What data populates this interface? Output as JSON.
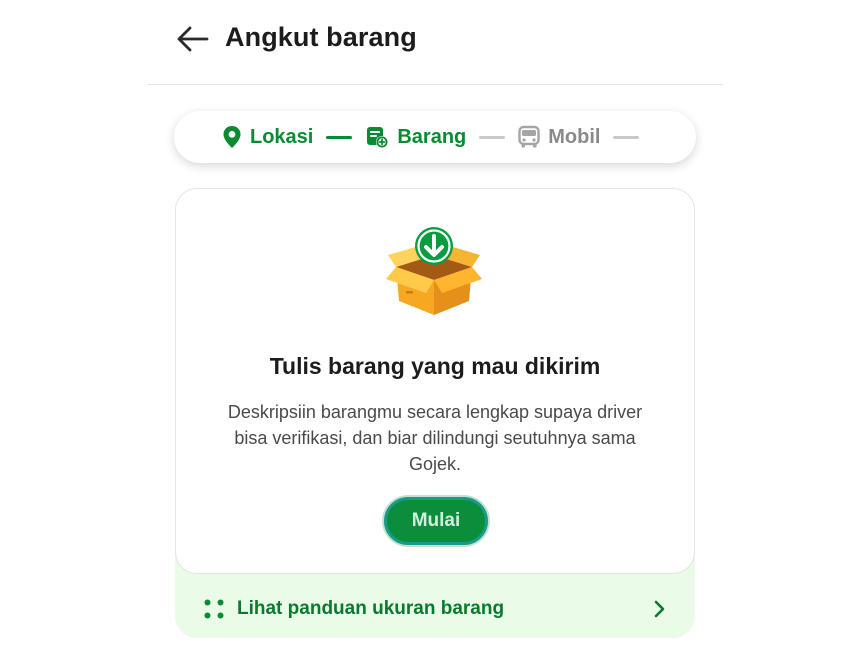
{
  "header": {
    "title": "Angkut barang",
    "back_icon": "arrow-left-icon"
  },
  "stepper": {
    "steps": [
      {
        "label": "Lokasi",
        "icon": "location-pin-icon",
        "state": "active"
      },
      {
        "label": "Barang",
        "icon": "package-add-icon",
        "state": "active"
      },
      {
        "label": "Mobil",
        "icon": "car-icon",
        "state": "inactive"
      }
    ]
  },
  "card": {
    "illustration": "open-box-download-icon",
    "title": "Tulis barang yang mau dikirim",
    "description": "Deskripsiin barangmu secara lengkap supaya driver bisa verifikasi, dan biar dilindungi seutuhnya sama Gojek.",
    "start_label": "Mulai"
  },
  "guide": {
    "label": "Lihat panduan ukuran barang",
    "icon": "four-dots-icon",
    "chevron": "chevron-right-icon"
  },
  "colors": {
    "primary": "#0a8a32",
    "inactive": "#8a8a8a",
    "guide_bg": "#eafbe8",
    "button_bg": "#0a8e3c"
  }
}
